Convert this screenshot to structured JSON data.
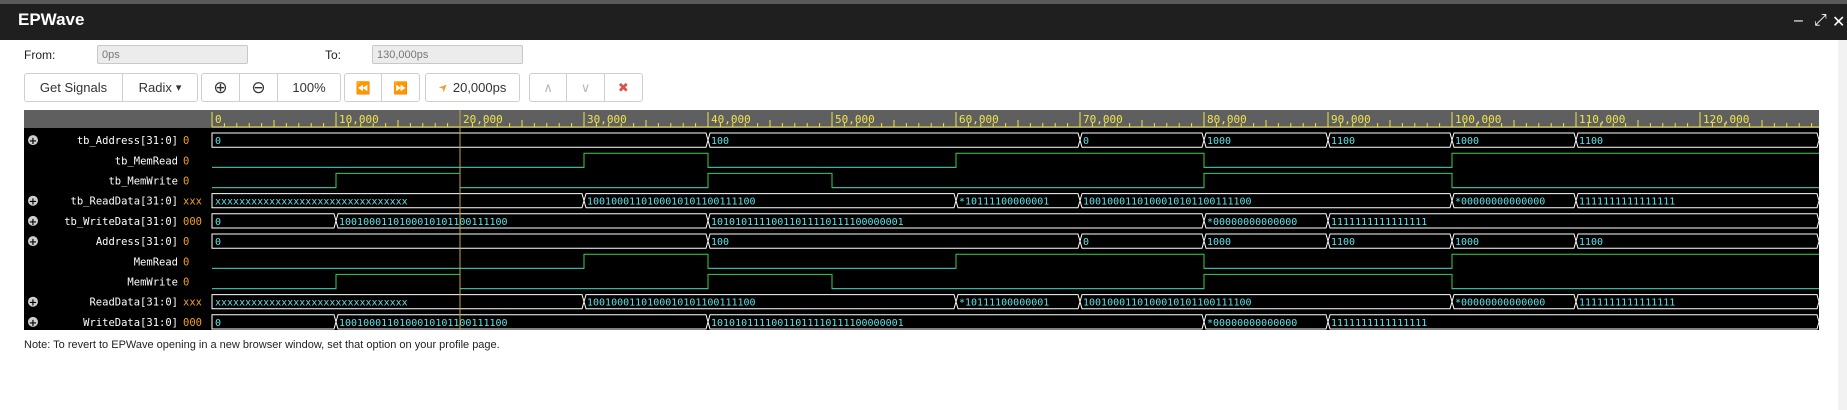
{
  "window": {
    "title": "EPWave",
    "minimize_glyph": "‒",
    "maximize_glyph": "⤢",
    "close_glyph": "✕"
  },
  "range": {
    "from_label": "From:",
    "from_value": "0ps",
    "to_label": "To:",
    "to_value": "130,000ps"
  },
  "toolbar": {
    "get_signals": "Get Signals",
    "radix": "Radix",
    "radix_caret": "▾",
    "zoom_in_glyph": "⊕",
    "zoom_out_glyph": "⊖",
    "zoom_level": "100%",
    "rewind_glyph": "⏪",
    "forward_glyph": "⏩",
    "cursor_glyph": "➤",
    "cursor_time": "20,000ps",
    "up_glyph": "∧",
    "down_glyph": "∨",
    "close_glyph": "✖"
  },
  "timeline": {
    "start": 0,
    "end": 130000,
    "major_step": 10000,
    "cursor_time": 20000,
    "tick_labels": [
      "0",
      "10,000",
      "20,000",
      "30,000",
      "40,000",
      "50,000",
      "60,000",
      "70,000",
      "80,000",
      "90,000",
      "100,000",
      "110,000",
      "120,000"
    ]
  },
  "colors": {
    "wave_bg": "#000000",
    "ruler_bg": "#5f5f5f",
    "ruler_text": "#f0e64a",
    "cursor": "#c9a336",
    "bus": "#ffffff",
    "bus_text": "#5fe3e8",
    "bit": "#39d04a",
    "bit_low": "#3bb7b7",
    "signal_name": "#ffffff",
    "signal_value": "#f0a020",
    "expand": "#cfcfcf"
  },
  "signals": [
    {
      "name": "tb_Address[31:0]",
      "value": "0",
      "type": "bus",
      "expandable": true,
      "segments": [
        {
          "t": 0,
          "v": "0"
        },
        {
          "t": 40000,
          "v": "100"
        },
        {
          "t": 70000,
          "v": "0"
        },
        {
          "t": 80000,
          "v": "1000"
        },
        {
          "t": 90000,
          "v": "1100"
        },
        {
          "t": 100000,
          "v": "1000"
        },
        {
          "t": 110000,
          "v": "1100"
        }
      ]
    },
    {
      "name": "tb_MemRead",
      "value": "0",
      "type": "bit",
      "expandable": false,
      "changes": [
        {
          "t": 0,
          "v": 0
        },
        {
          "t": 30000,
          "v": 1
        },
        {
          "t": 40000,
          "v": 0
        },
        {
          "t": 60000,
          "v": 1
        },
        {
          "t": 80000,
          "v": 0
        },
        {
          "t": 100000,
          "v": 1
        }
      ]
    },
    {
      "name": "tb_MemWrite",
      "value": "0",
      "type": "bit",
      "expandable": false,
      "changes": [
        {
          "t": 0,
          "v": 0
        },
        {
          "t": 10000,
          "v": 1
        },
        {
          "t": 20000,
          "v": 0
        },
        {
          "t": 40000,
          "v": 1
        },
        {
          "t": 50000,
          "v": 0
        },
        {
          "t": 80000,
          "v": 1
        },
        {
          "t": 100000,
          "v": 0
        }
      ]
    },
    {
      "name": "tb_ReadData[31:0]",
      "value": "xxx",
      "type": "bus",
      "expandable": true,
      "segments": [
        {
          "t": 0,
          "v": "xxxxxxxxxxxxxxxxxxxxxxxxxxxxxxxx"
        },
        {
          "t": 30000,
          "v": "1001000110100010101100111100"
        },
        {
          "t": 60000,
          "v": "*10111100000001"
        },
        {
          "t": 70000,
          "v": "1001000110100010101100111100"
        },
        {
          "t": 100000,
          "v": "*00000000000000"
        },
        {
          "t": 110000,
          "v": "1111111111111111"
        }
      ]
    },
    {
      "name": "tb_WriteData[31:0]",
      "value": "000",
      "type": "bus",
      "expandable": true,
      "segments": [
        {
          "t": 0,
          "v": "0"
        },
        {
          "t": 10000,
          "v": "1001000110100010101100111100"
        },
        {
          "t": 40000,
          "v": "10101011110011011110111100000001"
        },
        {
          "t": 80000,
          "v": "*00000000000000"
        },
        {
          "t": 90000,
          "v": "1111111111111111"
        }
      ]
    },
    {
      "name": "Address[31:0]",
      "value": "0",
      "type": "bus",
      "expandable": true,
      "segments": [
        {
          "t": 0,
          "v": "0"
        },
        {
          "t": 40000,
          "v": "100"
        },
        {
          "t": 70000,
          "v": "0"
        },
        {
          "t": 80000,
          "v": "1000"
        },
        {
          "t": 90000,
          "v": "1100"
        },
        {
          "t": 100000,
          "v": "1000"
        },
        {
          "t": 110000,
          "v": "1100"
        }
      ]
    },
    {
      "name": "MemRead",
      "value": "0",
      "type": "bit",
      "expandable": false,
      "changes": [
        {
          "t": 0,
          "v": 0
        },
        {
          "t": 30000,
          "v": 1
        },
        {
          "t": 40000,
          "v": 0
        },
        {
          "t": 60000,
          "v": 1
        },
        {
          "t": 80000,
          "v": 0
        },
        {
          "t": 100000,
          "v": 1
        }
      ]
    },
    {
      "name": "MemWrite",
      "value": "0",
      "type": "bit",
      "expandable": false,
      "changes": [
        {
          "t": 0,
          "v": 0
        },
        {
          "t": 10000,
          "v": 1
        },
        {
          "t": 20000,
          "v": 0
        },
        {
          "t": 40000,
          "v": 1
        },
        {
          "t": 50000,
          "v": 0
        },
        {
          "t": 80000,
          "v": 1
        },
        {
          "t": 100000,
          "v": 0
        }
      ]
    },
    {
      "name": "ReadData[31:0]",
      "value": "xxx",
      "type": "bus",
      "expandable": true,
      "segments": [
        {
          "t": 0,
          "v": "xxxxxxxxxxxxxxxxxxxxxxxxxxxxxxxx"
        },
        {
          "t": 30000,
          "v": "1001000110100010101100111100"
        },
        {
          "t": 60000,
          "v": "*10111100000001"
        },
        {
          "t": 70000,
          "v": "1001000110100010101100111100"
        },
        {
          "t": 100000,
          "v": "*00000000000000"
        },
        {
          "t": 110000,
          "v": "1111111111111111"
        }
      ]
    },
    {
      "name": "WriteData[31:0]",
      "value": "000",
      "type": "bus",
      "expandable": true,
      "segments": [
        {
          "t": 0,
          "v": "0"
        },
        {
          "t": 10000,
          "v": "1001000110100010101100111100"
        },
        {
          "t": 40000,
          "v": "10101011110011011110111100000001"
        },
        {
          "t": 80000,
          "v": "*00000000000000"
        },
        {
          "t": 90000,
          "v": "1111111111111111"
        }
      ]
    }
  ],
  "note": "Note: To revert to EPWave opening in a new browser window, set that option on your profile page."
}
